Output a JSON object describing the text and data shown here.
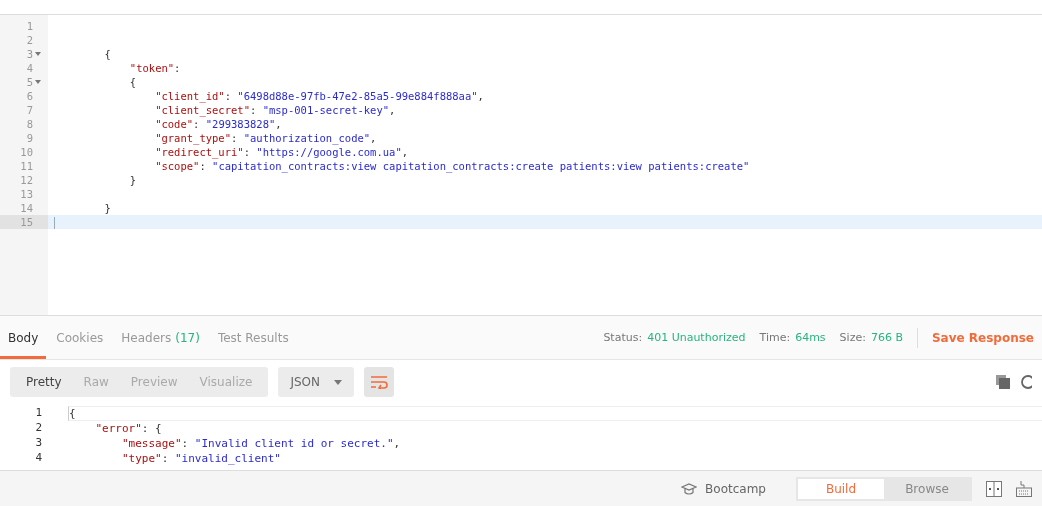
{
  "request_editor": {
    "lines": [
      {
        "number": "1",
        "foldable": false,
        "current": false
      },
      {
        "number": "2",
        "foldable": false,
        "current": false
      },
      {
        "number": "3",
        "foldable": true,
        "current": false,
        "tokens": [
          {
            "kind": "punct",
            "text": "        {"
          }
        ]
      },
      {
        "number": "4",
        "foldable": false,
        "current": false,
        "tokens": [
          {
            "kind": "key",
            "text": "            \"token\""
          },
          {
            "kind": "punct",
            "text": ":"
          }
        ]
      },
      {
        "number": "5",
        "foldable": true,
        "current": false,
        "tokens": [
          {
            "kind": "punct",
            "text": "            {"
          }
        ]
      },
      {
        "number": "6",
        "foldable": false,
        "current": false,
        "tokens": [
          {
            "kind": "key",
            "text": "                \"client_id\""
          },
          {
            "kind": "punct",
            "text": ": "
          },
          {
            "kind": "string",
            "text": "\"6498d88e-97fb-47e2-85a5-99e884f888aa\""
          },
          {
            "kind": "punct",
            "text": ","
          }
        ]
      },
      {
        "number": "7",
        "foldable": false,
        "current": false,
        "tokens": [
          {
            "kind": "key",
            "text": "                \"client_secret\""
          },
          {
            "kind": "punct",
            "text": ": "
          },
          {
            "kind": "string",
            "text": "\"msp-001-secret-key\""
          },
          {
            "kind": "punct",
            "text": ","
          }
        ]
      },
      {
        "number": "8",
        "foldable": false,
        "current": false,
        "tokens": [
          {
            "kind": "key",
            "text": "                \"code\""
          },
          {
            "kind": "punct",
            "text": ": "
          },
          {
            "kind": "string",
            "text": "\"299383828\""
          },
          {
            "kind": "punct",
            "text": ","
          }
        ]
      },
      {
        "number": "9",
        "foldable": false,
        "current": false,
        "tokens": [
          {
            "kind": "key",
            "text": "                \"grant_type\""
          },
          {
            "kind": "punct",
            "text": ": "
          },
          {
            "kind": "string",
            "text": "\"authorization_code\""
          },
          {
            "kind": "punct",
            "text": ","
          }
        ]
      },
      {
        "number": "10",
        "foldable": false,
        "current": false,
        "tokens": [
          {
            "kind": "key",
            "text": "                \"redirect_uri\""
          },
          {
            "kind": "punct",
            "text": ": "
          },
          {
            "kind": "string",
            "text": "\"https://google.com.ua\""
          },
          {
            "kind": "punct",
            "text": ","
          }
        ]
      },
      {
        "number": "11",
        "foldable": false,
        "current": false,
        "tokens": [
          {
            "kind": "key",
            "text": "                \"scope\""
          },
          {
            "kind": "punct",
            "text": ": "
          },
          {
            "kind": "string",
            "text": "\"capitation_contracts:view capitation_contracts:create patients:view patients:create\""
          }
        ]
      },
      {
        "number": "12",
        "foldable": false,
        "current": false,
        "tokens": [
          {
            "kind": "punct",
            "text": "            }"
          }
        ]
      },
      {
        "number": "13",
        "foldable": false,
        "current": false
      },
      {
        "number": "14",
        "foldable": false,
        "current": false,
        "tokens": [
          {
            "kind": "punct",
            "text": "        }"
          }
        ]
      },
      {
        "number": "15",
        "foldable": false,
        "current": true
      }
    ]
  },
  "response_tabs": [
    {
      "label": "Body",
      "selected": true
    },
    {
      "label": "Cookies",
      "selected": false
    },
    {
      "label": "Headers",
      "count": "(17)",
      "selected": false
    },
    {
      "label": "Test Results",
      "selected": false
    }
  ],
  "response_meta": [
    {
      "label": "Status:",
      "value": "401 Unauthorized"
    },
    {
      "label": "Time:",
      "value": "64ms"
    },
    {
      "label": "Size:",
      "value": "766 B"
    }
  ],
  "save_response": "Save Response",
  "view_modes": [
    {
      "label": "Pretty",
      "selected": true
    },
    {
      "label": "Raw",
      "selected": false
    },
    {
      "label": "Preview",
      "selected": false
    },
    {
      "label": "Visualize",
      "selected": false
    }
  ],
  "format": "JSON",
  "response_body": {
    "lines": [
      {
        "number": "1",
        "current": true,
        "tokens": [
          {
            "kind": "punct",
            "text": "{"
          }
        ]
      },
      {
        "number": "2",
        "current": false,
        "tokens": [
          {
            "kind": "key",
            "text": "    \"error\""
          },
          {
            "kind": "punct",
            "text": ": {"
          }
        ]
      },
      {
        "number": "3",
        "current": false,
        "tokens": [
          {
            "kind": "key",
            "text": "        \"message\""
          },
          {
            "kind": "punct",
            "text": ": "
          },
          {
            "kind": "string",
            "text": "\"Invalid client id or secret.\""
          },
          {
            "kind": "punct",
            "text": ","
          }
        ]
      },
      {
        "number": "4",
        "current": false,
        "tokens": [
          {
            "kind": "key",
            "text": "        \"type\""
          },
          {
            "kind": "punct",
            "text": ": "
          },
          {
            "kind": "string",
            "text": "\"invalid_client\""
          }
        ]
      }
    ]
  },
  "footer": {
    "bootcamp": "Bootcamp",
    "modes": [
      {
        "label": "Build",
        "selected": true
      },
      {
        "label": "Browse",
        "selected": false
      }
    ]
  }
}
